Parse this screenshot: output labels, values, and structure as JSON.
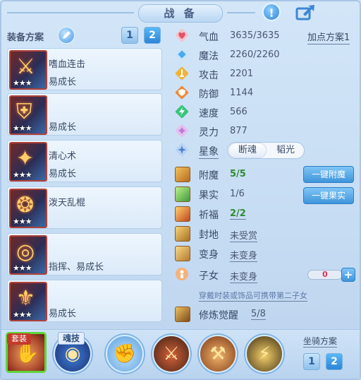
{
  "header": {
    "title": "战 备"
  },
  "left": {
    "plan_label": "装备方案",
    "plans": [
      "1",
      "2"
    ],
    "equipment": [
      {
        "name": "嗜血连击",
        "tag": "易成长",
        "stars": "★★★",
        "icon": "sword-icon"
      },
      {
        "name": "",
        "tag": "易成长",
        "stars": "★★★",
        "icon": "armor-icon"
      },
      {
        "name": "清心术",
        "tag": "易成长",
        "stars": "★★★",
        "icon": "necklace-icon"
      },
      {
        "name": "泼天乱棍",
        "tag": "",
        "stars": "★★★",
        "icon": "belt-icon"
      },
      {
        "name": "",
        "tag": "指挥、易成长",
        "stars": "★★★",
        "icon": "ring-icon"
      },
      {
        "name": "",
        "tag": "易成长",
        "stars": "★★★",
        "icon": "boots-icon"
      }
    ]
  },
  "stats": {
    "assign_label": "加点方案1",
    "rows": [
      {
        "name": "气血",
        "value": "3635/3635",
        "icon": "heart-icon",
        "color": "#e8506a"
      },
      {
        "name": "魔法",
        "value": "2260/2260",
        "icon": "diamond-icon",
        "color": "#4aa8f0"
      },
      {
        "name": "攻击",
        "value": "2201",
        "icon": "sword-icon",
        "color": "#f2b233"
      },
      {
        "name": "防御",
        "value": "1144",
        "icon": "shield-icon",
        "color": "#f08a3a"
      },
      {
        "name": "速度",
        "value": "566",
        "icon": "lightning-icon",
        "color": "#39c47a"
      },
      {
        "name": "灵力",
        "value": "877",
        "icon": "spirit-icon",
        "color": "#c07ad8"
      }
    ],
    "constellation": {
      "name": "星象",
      "options": [
        "断魂",
        "韬光"
      ],
      "selected": "断魂"
    }
  },
  "enhance": {
    "rows": [
      {
        "name": "附魔",
        "value": "5/5",
        "green": true
      },
      {
        "name": "果实",
        "value": "1/6",
        "green": false
      },
      {
        "name": "祈福",
        "value": "2/2",
        "green": true
      },
      {
        "name": "封地",
        "value": "未受赏",
        "green": false
      },
      {
        "name": "变身",
        "value": "未变身",
        "green": false
      },
      {
        "name": "子女",
        "value": "未变身",
        "green": false
      }
    ],
    "buttons": {
      "enchant": "一键附魔",
      "fruit": "一键果实"
    },
    "child_count": "0",
    "hint": "穿戴时装或饰品可携带第二子女",
    "cultivation": {
      "name": "修炼觉醒",
      "value": "5/8"
    }
  },
  "bottom": {
    "suit_label": "套装",
    "soul_label": "魂技",
    "mount_label": "坐骑方案",
    "mount_plans": [
      "1",
      "2"
    ]
  },
  "colors": {
    "green_value": "#2f8a2f",
    "accent_blue": "#3f95db",
    "child_count": "#d8305a"
  }
}
